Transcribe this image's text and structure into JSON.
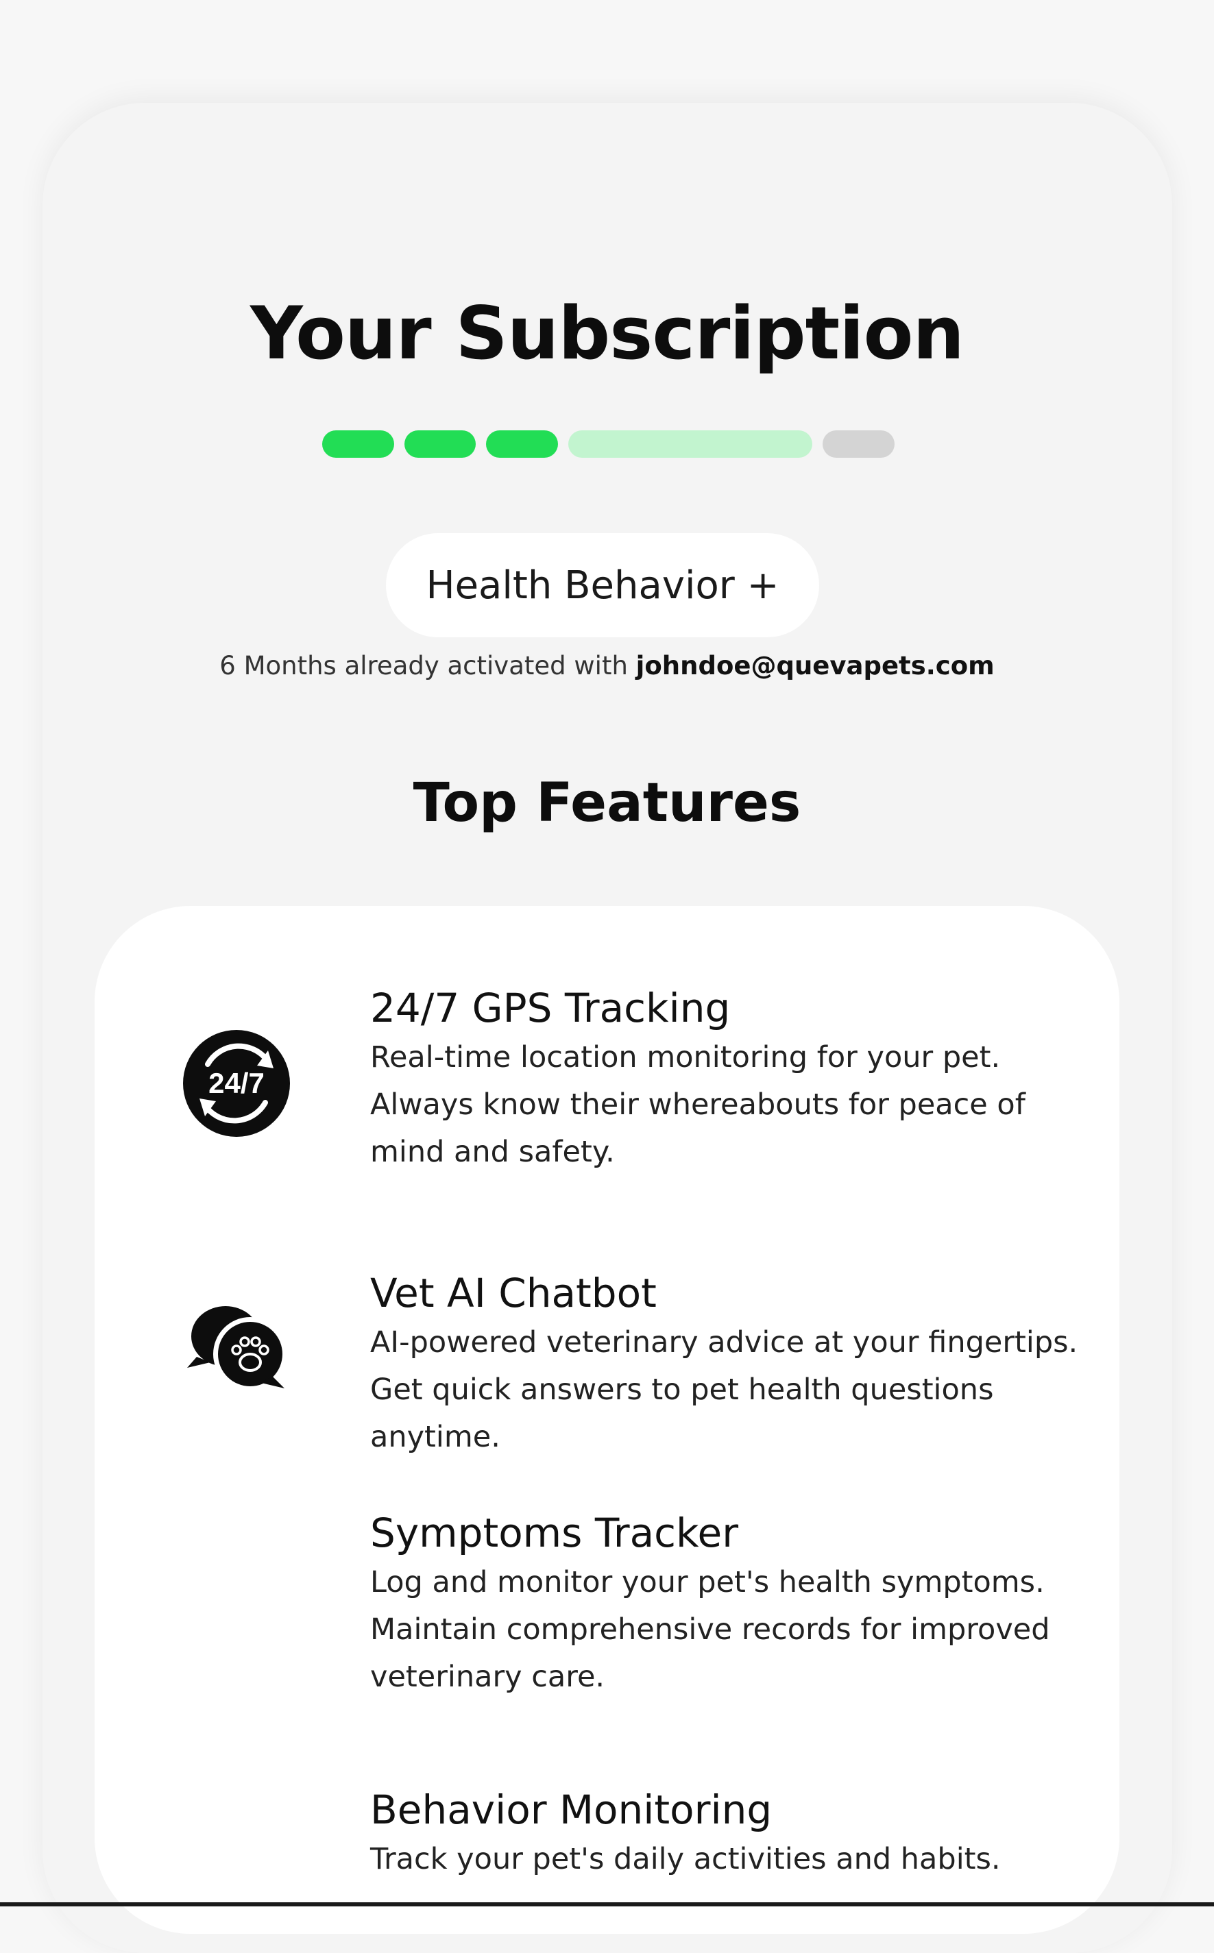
{
  "header": {
    "title": "Your Subscription"
  },
  "progress": {
    "steps_total": 5,
    "steps_completed": 3,
    "current_step": 4
  },
  "plan": {
    "name": "Health Behavior +"
  },
  "activation": {
    "prefix": "6 Months already activated with",
    "email": "johndoe@quevapets.com"
  },
  "features_section": {
    "title": "Top Features",
    "items": [
      {
        "title": "24/7 GPS Tracking",
        "description": "Real-time location monitoring for your pet. Always know their whereabouts for peace of mind and safety.",
        "icon": "clock-24-7-icon",
        "icon_text": "24/7"
      },
      {
        "title": "Vet AI Chatbot",
        "description": "AI-powered veterinary advice at your fingertips. Get quick answers to pet health questions anytime.",
        "icon": "paw-chat-bubbles-icon"
      },
      {
        "title": "Symptoms Tracker",
        "description": "Log and monitor your pet's health symptoms. Maintain comprehensive records for improved veterinary care."
      },
      {
        "title": "Behavior Monitoring",
        "description": "Track your pet's daily activities and habits."
      }
    ]
  },
  "colors": {
    "progress_done": "#22dd55",
    "progress_current": "#c2f4cf",
    "progress_todo": "#d4d4d4",
    "background": "#f4f4f4",
    "card": "#ffffff",
    "text": "#111111"
  }
}
